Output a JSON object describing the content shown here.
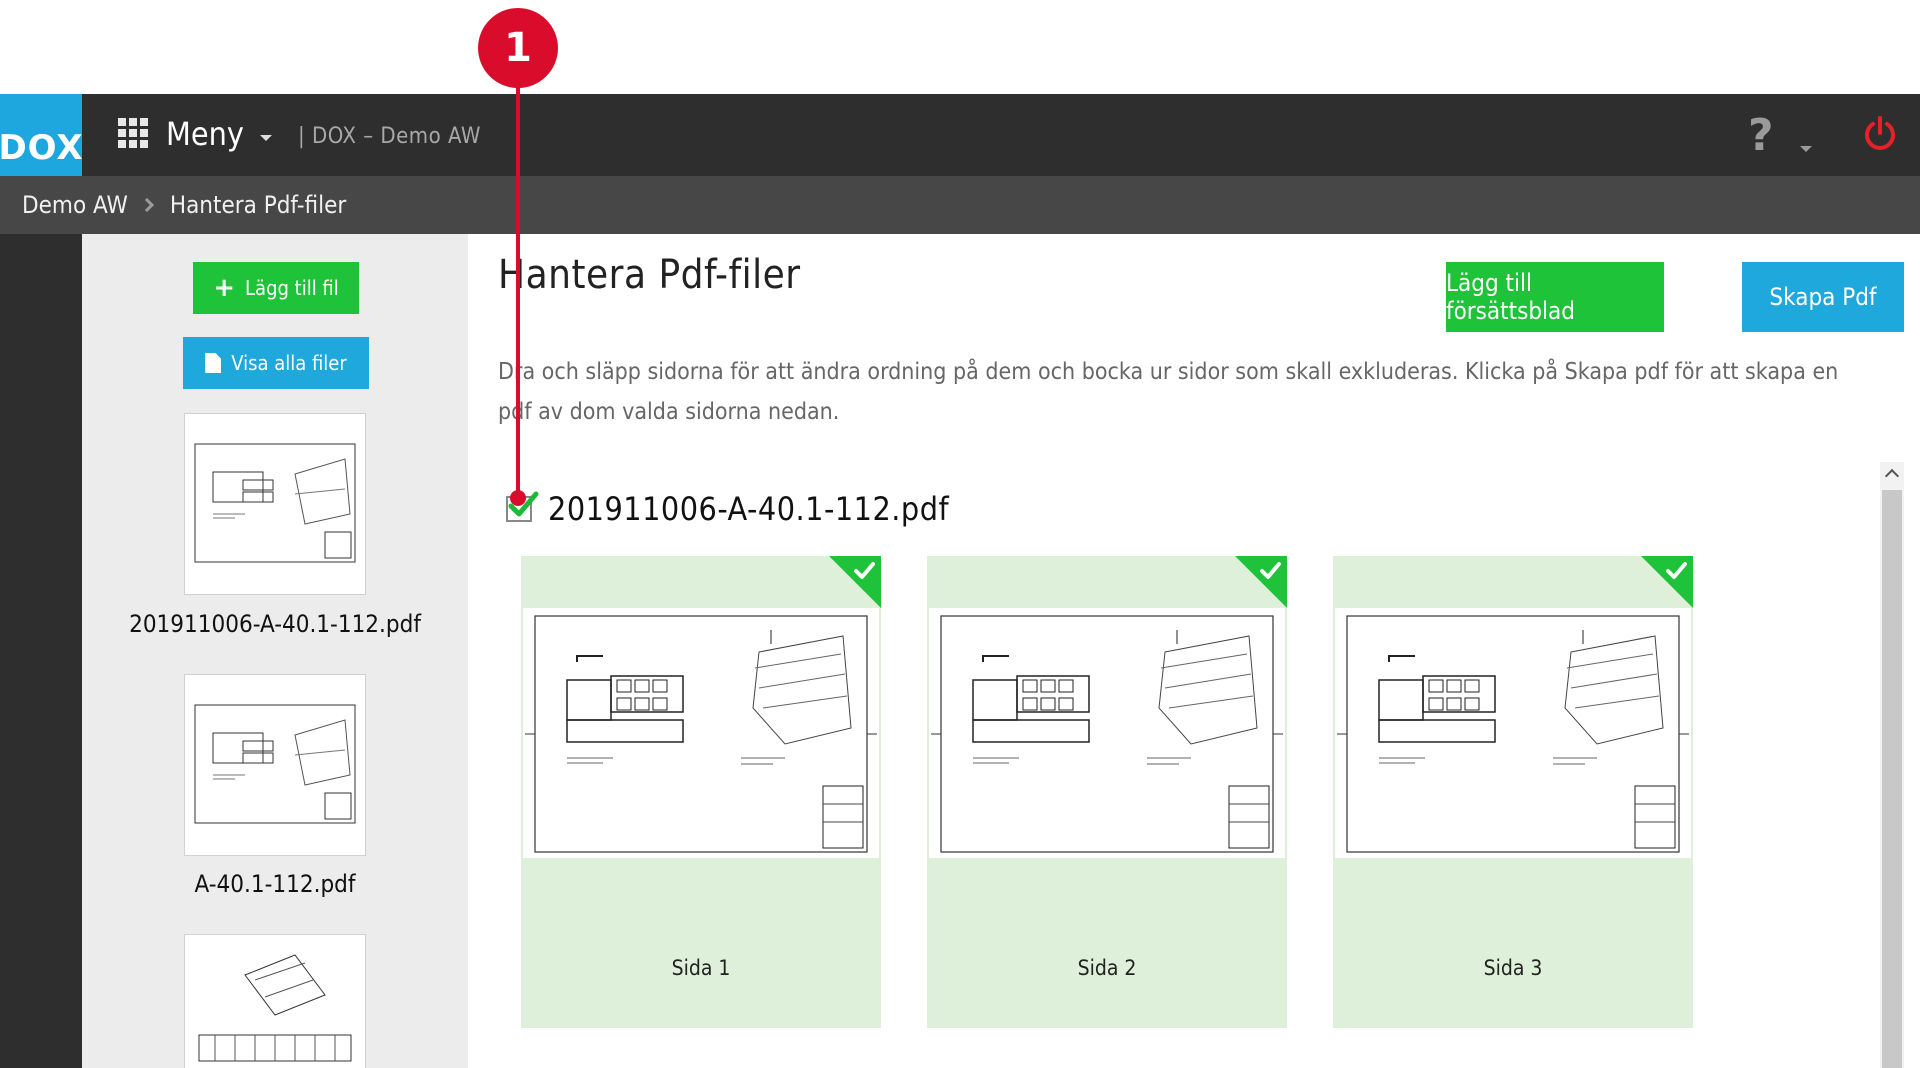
{
  "annotation": {
    "marker_number": "1"
  },
  "topbar": {
    "logo": "DOX",
    "menu_label": "Meny",
    "title": "| DOX – Demo AW",
    "help_symbol": "?"
  },
  "breadcrumb": {
    "items": [
      "Demo AW",
      "Hantera Pdf-filer"
    ]
  },
  "sidebar": {
    "add_file_label": "Lägg till fil",
    "show_all_label": "Visa alla filer",
    "files": [
      {
        "name": "201911006-A-40.1-112.pdf"
      },
      {
        "name": "A-40.1-112.pdf"
      },
      {
        "name": ""
      }
    ]
  },
  "main": {
    "title": "Hantera Pdf-filer",
    "add_cover_label": "Lägg till försättsblad",
    "create_pdf_label": "Skapa Pdf",
    "description": "Dra och släpp sidorna för att ändra ordning på dem och bocka ur sidor som skall exkluderas. Klicka på Skapa pdf för att skapa en pdf av dom valda sidorna nedan.",
    "file": {
      "name": "201911006-A-40.1-112.pdf",
      "checked": true,
      "pages": [
        {
          "label": "Sida 1",
          "selected": true
        },
        {
          "label": "Sida 2",
          "selected": true
        },
        {
          "label": "Sida 3",
          "selected": true
        }
      ]
    }
  },
  "colors": {
    "brand_blue": "#1ea7de",
    "accent_green": "#1fc33a",
    "page_card_bg": "#dff0da",
    "annotation_red": "#d90d2b",
    "topbar": "#2e2e2e",
    "breadcrumb_bar": "#474747"
  }
}
